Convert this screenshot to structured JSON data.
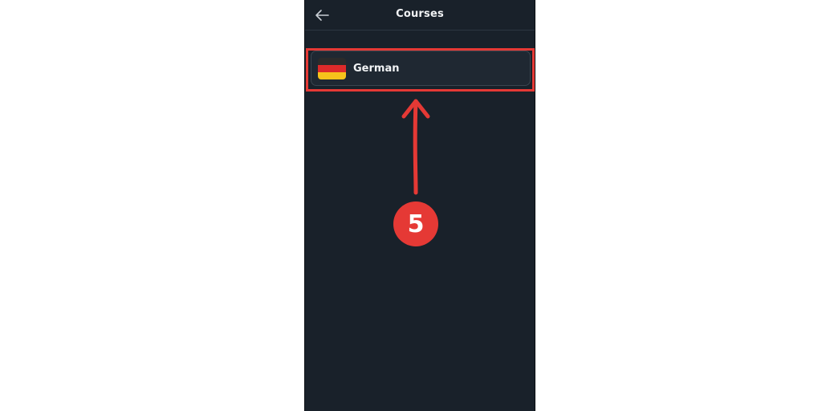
{
  "header": {
    "title": "Courses",
    "back_icon": "arrow-left-icon"
  },
  "courses": [
    {
      "name": "German",
      "flag_icon": "germany-flag-icon",
      "flag_colors": [
        "#2b2b2b",
        "#dd2a2a",
        "#f6c21b"
      ]
    }
  ],
  "annotation": {
    "step_number": "5",
    "color": "#e53935"
  },
  "colors": {
    "background": "#19212a",
    "card": "#1f2832",
    "text": "#f1f3f5"
  }
}
